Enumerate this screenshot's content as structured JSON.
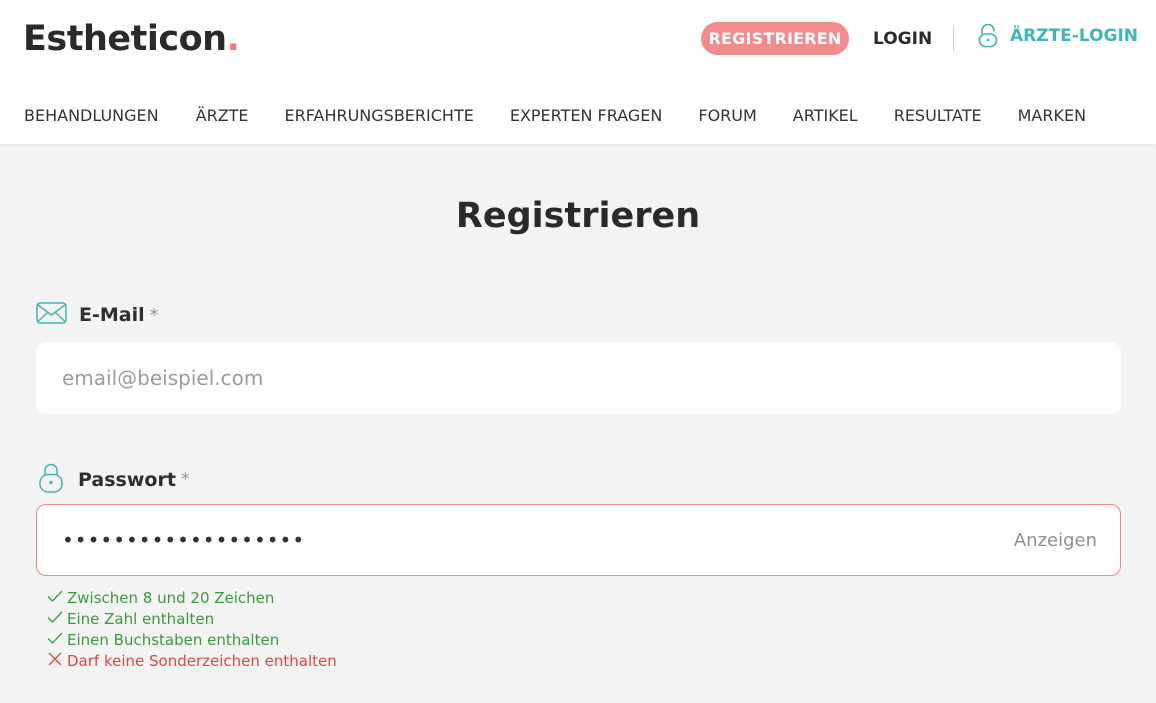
{
  "header": {
    "logo_text": "Estheticon",
    "logo_dot": ".",
    "register_label": "REGISTRIEREN",
    "login_label": "LOGIN",
    "doctor_login_label": "ÄRZTE-LOGIN"
  },
  "nav": {
    "items": [
      {
        "label": "BEHANDLUNGEN"
      },
      {
        "label": "ÄRZTE"
      },
      {
        "label": "ERFAHRUNGSBERICHTE"
      },
      {
        "label": "EXPERTEN FRAGEN"
      },
      {
        "label": "FORUM"
      },
      {
        "label": "ARTIKEL"
      },
      {
        "label": "RESULTATE"
      },
      {
        "label": "MARKEN"
      }
    ]
  },
  "main": {
    "title": "Registrieren",
    "email": {
      "label": "E-Mail",
      "required_mark": "*",
      "value": "",
      "placeholder": "email@beispiel.com",
      "icon": "envelope-icon"
    },
    "password": {
      "label": "Passwort",
      "required_mark": "*",
      "masked_value": "•••••••••••••••••••",
      "show_label": "Anzeigen",
      "icon": "lock-icon"
    },
    "rules": [
      {
        "text": "Zwischen 8 und 20 Zeichen",
        "status": "ok",
        "icon": "check-icon"
      },
      {
        "text": "Eine Zahl enthalten",
        "status": "ok",
        "icon": "check-icon"
      },
      {
        "text": "Einen Buchstaben enthalten",
        "status": "ok",
        "icon": "check-icon"
      },
      {
        "text": "Darf keine Sonderzeichen enthalten",
        "status": "error",
        "icon": "cross-icon"
      }
    ]
  },
  "colors": {
    "accent_pink": "#f28b8b",
    "accent_teal": "#3fb6b0",
    "ok_green": "#3a9a3e",
    "error_red": "#e04545",
    "background": "#f3f3f3"
  }
}
